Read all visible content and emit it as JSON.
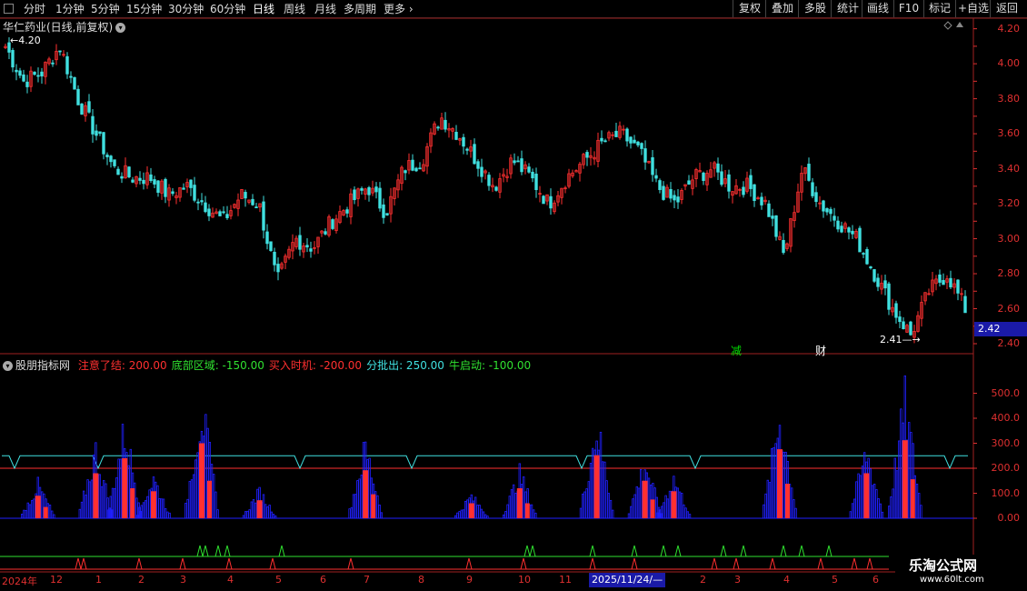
{
  "toolbar": {
    "periods": [
      "分时",
      "1分钟",
      "5分钟",
      "15分钟",
      "30分钟",
      "60分钟",
      "日线",
      "周线",
      "月线",
      "多周期",
      "更多"
    ],
    "active": "日线",
    "right_buttons": [
      "复权",
      "叠加",
      "多股",
      "统计",
      "画线",
      "F10",
      "标记",
      "+自选",
      "返回"
    ]
  },
  "price_panel": {
    "title": "华仁药业(日线,前复权)",
    "high_label": "4.20",
    "low_label": "2.41",
    "current_price": "2.42",
    "y_axis": [
      "4.20",
      "4.00",
      "3.80",
      "3.60",
      "3.40",
      "3.20",
      "3.00",
      "2.80",
      "2.60",
      "2.40"
    ],
    "markers": [
      {
        "text": "减",
        "color": "#00e000"
      },
      {
        "text": "财",
        "color": "#ffffff"
      }
    ]
  },
  "indicator_panel": {
    "name": "股朋指标网",
    "series_labels": [
      {
        "text": "注意了结: 200.00",
        "color": "#ff3030"
      },
      {
        "text": "底部区域: -150.00",
        "color": "#30e030"
      },
      {
        "text": "买入时机: -200.00",
        "color": "#ff3030"
      },
      {
        "text": "分批出: 250.00",
        "color": "#40e0e0"
      },
      {
        "text": "牛启动: -100.00",
        "color": "#30e030"
      }
    ],
    "y_axis": [
      "500.0",
      "400.0",
      "300.0",
      "200.0",
      "100.0",
      "0.00"
    ]
  },
  "x_axis": {
    "labels": [
      "2024年",
      "12",
      "1",
      "2",
      "3",
      "4",
      "5",
      "6",
      "7",
      "8",
      "9",
      "10",
      "11",
      "2",
      "3",
      "4",
      "5",
      "6"
    ],
    "cursor_date": "2025/11/24/—"
  },
  "watermark": {
    "name": "乐淘公式网",
    "url": "www.60lt.com"
  },
  "colors": {
    "up": "#ff3030",
    "down": "#40e0e0",
    "axis": "#e03030",
    "blue": "#2020ff",
    "cyan": "#40e0e0",
    "green": "#30e030"
  },
  "chart_data": [
    {
      "type": "candlestick",
      "title": "华仁药业(日线,前复权)",
      "ylim": [
        2.4,
        4.25
      ],
      "anchors_close": [
        4.1,
        3.9,
        3.95,
        4.1,
        3.8,
        3.6,
        3.4,
        3.35,
        3.35,
        3.25,
        3.3,
        3.2,
        3.1,
        3.25,
        3.2,
        2.75,
        3.0,
        2.95,
        3.1,
        3.2,
        3.3,
        3.15,
        3.4,
        3.45,
        3.7,
        3.6,
        3.45,
        3.3,
        3.45,
        3.35,
        3.2,
        3.35,
        3.45,
        3.55,
        3.6,
        3.5,
        3.3,
        3.2,
        3.35,
        3.4,
        3.3,
        3.3,
        3.2,
        2.9,
        3.4,
        3.2,
        3.1,
        3.0,
        2.8,
        2.6,
        2.45,
        2.7,
        2.8,
        2.6
      ]
    },
    {
      "type": "bar",
      "title": "股朋指标网",
      "ylim": [
        0,
        600
      ],
      "reference_lines": {
        "注意了结": 200,
        "分批出": 250
      },
      "events_at_fraction": [
        0.03,
        0.09,
        0.12,
        0.15,
        0.2,
        0.26,
        0.37,
        0.48,
        0.53,
        0.61,
        0.66,
        0.69,
        0.8,
        0.89,
        0.93
      ]
    }
  ]
}
